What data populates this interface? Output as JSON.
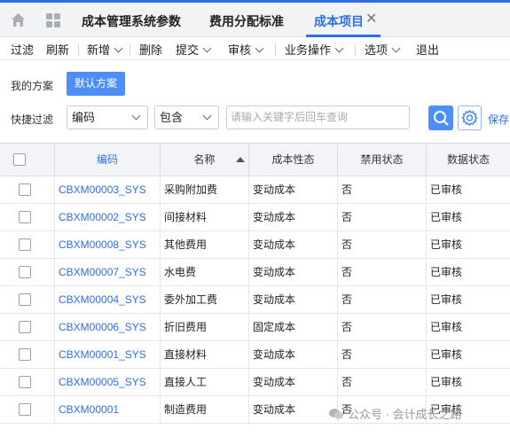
{
  "tabs": {
    "items": [
      {
        "label": "成本管理系统参数"
      },
      {
        "label": "费用分配标准"
      },
      {
        "label": "成本项目"
      }
    ]
  },
  "toolbar": {
    "filter": "过滤",
    "refresh": "刷新",
    "add": "新增",
    "delete": "删除",
    "submit": "提交",
    "audit": "审核",
    "business_ops": "业务操作",
    "options": "选项",
    "exit": "退出"
  },
  "plan": {
    "label": "我的方案",
    "default_button": "默认方案"
  },
  "quick_filter": {
    "label": "快捷过滤",
    "field_value": "编码",
    "operator_value": "包含",
    "search_placeholder": "请输入关键字后回车查询",
    "save_label": "保存"
  },
  "table": {
    "headers": {
      "code": "编码",
      "name": "名称",
      "nature": "成本性态",
      "disabled": "禁用状态",
      "data_status": "数据状态"
    },
    "rows": [
      {
        "code": "CBXM00003_SYS",
        "name": "采购附加费",
        "nature": "变动成本",
        "disabled": "否",
        "status": "已审核"
      },
      {
        "code": "CBXM00002_SYS",
        "name": "间接材料",
        "nature": "变动成本",
        "disabled": "否",
        "status": "已审核"
      },
      {
        "code": "CBXM00008_SYS",
        "name": "其他费用",
        "nature": "变动成本",
        "disabled": "否",
        "status": "已审核"
      },
      {
        "code": "CBXM00007_SYS",
        "name": "水电费",
        "nature": "变动成本",
        "disabled": "否",
        "status": "已审核"
      },
      {
        "code": "CBXM00004_SYS",
        "name": "委外加工费",
        "nature": "变动成本",
        "disabled": "否",
        "status": "已审核"
      },
      {
        "code": "CBXM00006_SYS",
        "name": "折旧费用",
        "nature": "固定成本",
        "disabled": "否",
        "status": "已审核"
      },
      {
        "code": "CBXM00001_SYS",
        "name": "直接材料",
        "nature": "变动成本",
        "disabled": "否",
        "status": "已审核"
      },
      {
        "code": "CBXM00005_SYS",
        "name": "直接人工",
        "nature": "变动成本",
        "disabled": "否",
        "status": "已审核"
      },
      {
        "code": "CBXM00001",
        "name": "制造费用",
        "nature": "变动成本",
        "disabled": "否",
        "status": "已审核"
      }
    ]
  },
  "watermark": {
    "text": "公众号 · 会计成长之路"
  },
  "colors": {
    "accent": "#2f6fe4",
    "button_blue": "#4e8ef7"
  }
}
